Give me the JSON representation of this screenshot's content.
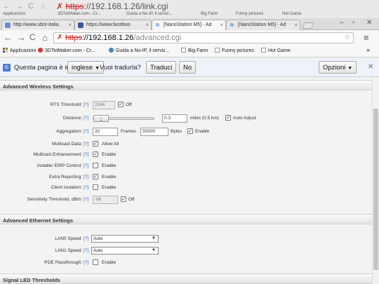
{
  "ghost": {
    "url_scheme": "https",
    "url_rest": "://192.168.1.26/link.cgi",
    "bookmarks": [
      "Applicazioni",
      "3DTotMaker.com - Cr...",
      "Guida a No-IP, il serviz...",
      "Big Farm",
      "Funny pictures",
      "Hot Game"
    ]
  },
  "tabs": [
    {
      "label": "http://www.ubnt-italia.",
      "type": "page"
    },
    {
      "label": "https://www.faceboo",
      "type": "fb"
    },
    {
      "label": "[NanoStation M5] - Ad",
      "type": "wifi"
    },
    {
      "label": "[NanoStation M5] - Ad",
      "type": "wifi"
    }
  ],
  "address": {
    "scheme": "https",
    "host": "://192.168.1.26",
    "path": "/advanced.cgi"
  },
  "bookmarks": [
    {
      "label": "Applicazioni",
      "icon": "apps-grid-icon"
    },
    {
      "label": "3DTotMaker.com - Cr...",
      "icon": "site-icon"
    },
    {
      "label": "Guida a No-IP, il serviz...",
      "icon": "site-icon"
    },
    {
      "label": "Big Farm",
      "icon": "page-icon"
    },
    {
      "label": "Funny pictures",
      "icon": "page-icon"
    },
    {
      "label": "Hot Game",
      "icon": "page-icon"
    }
  ],
  "translate_bar": {
    "prefix": "Questa pagina è in",
    "language": "inglese",
    "question": "Vuoi tradurla?",
    "translate_label": "Traduci",
    "no_label": "No",
    "options_label": "Opzioni"
  },
  "sections": {
    "wireless": "Advanced Wireless Settings",
    "ethernet": "Advanced Ethernet Settings",
    "led": "Signal LED Thresholds"
  },
  "help_text": "[?]",
  "wireless": {
    "rts": {
      "label": "RTS Threshold:",
      "value": "2346",
      "check_label": "Off",
      "checked": true
    },
    "distance": {
      "label": "Distance:",
      "value": "0.3",
      "unit": "miles (0.5 km)",
      "check_label": "Auto Adjust",
      "checked": true,
      "slider_level": 0
    },
    "aggregation": {
      "label": "Aggregation:",
      "frames": "32",
      "frames_unit": "Frames",
      "bytes": "50000",
      "bytes_unit": "Bytes",
      "check_label": "Enable",
      "checked": true
    },
    "multicast_data": {
      "label": "Multicast Data:",
      "check_label": "Allow All",
      "checked": true
    },
    "multicast_enh": {
      "label": "Multicast Enhancement:",
      "check_label": "Enable",
      "checked": true
    },
    "installer_erp": {
      "label": "Installer EIRP Control:",
      "check_label": "Enable",
      "checked": false
    },
    "extra_reporting": {
      "label": "Extra Reporting:",
      "check_label": "Enable",
      "checked": true
    },
    "client_isolation": {
      "label": "Client Isolation:",
      "check_label": "Enable",
      "checked": false
    },
    "sensitivity": {
      "label": "Sensitivity Threshold, dBm:",
      "value": "-96",
      "check_label": "Off",
      "checked": true
    }
  },
  "ethernet": {
    "lan0": {
      "label": "LAN0 Speed:",
      "value": "Auto"
    },
    "lan1": {
      "label": "LAN1 Speed:",
      "value": "Auto"
    },
    "poe": {
      "label": "POE Passthrough:",
      "check_label": "Enable",
      "checked": false
    }
  }
}
